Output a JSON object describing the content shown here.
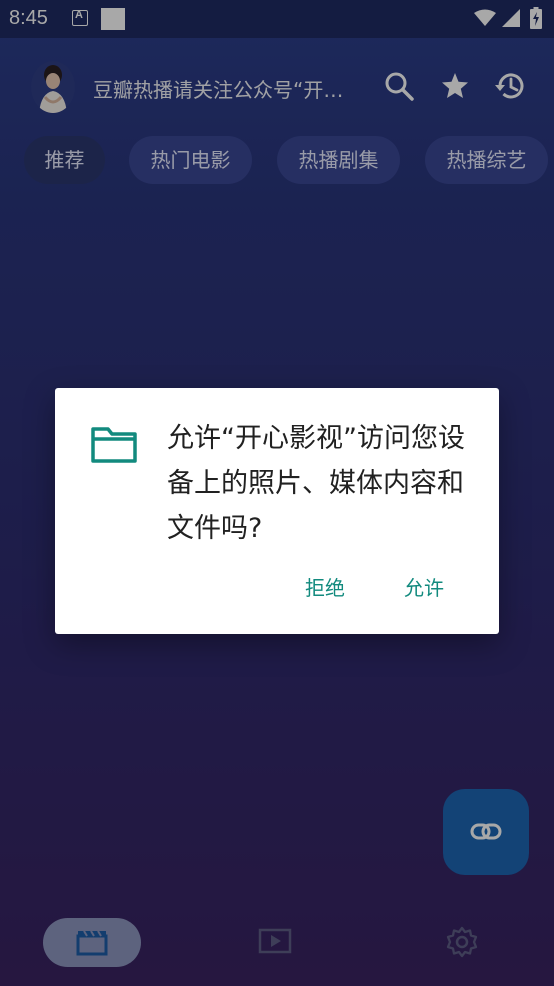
{
  "status_bar": {
    "time": "8:45",
    "notification_icon_letter": "A",
    "icons": [
      "a-app-icon",
      "white-square-icon",
      "wifi-icon",
      "signal-icon",
      "battery-charging-icon"
    ]
  },
  "app_bar": {
    "title": "豆瓣热播请关注公众号“开心影视”",
    "icons": [
      "search-icon",
      "star-icon",
      "history-icon"
    ]
  },
  "tabs": [
    {
      "label": "推荐",
      "active": true
    },
    {
      "label": "热门电影",
      "active": false
    },
    {
      "label": "热播剧集",
      "active": false
    },
    {
      "label": "热播综艺",
      "active": false
    }
  ],
  "dialog": {
    "icon": "folder-icon",
    "message": "允许“开心影视”访问您设备上的照片、媒体内容和文件吗?",
    "deny_label": "拒绝",
    "allow_label": "允许",
    "accent_color": "#128a7e"
  },
  "fab": {
    "icon": "link-icon"
  },
  "bottom_nav": {
    "items": [
      {
        "icon": "clapperboard-icon",
        "active": true
      },
      {
        "icon": "play-box-icon",
        "active": false
      },
      {
        "icon": "settings-gear-icon",
        "active": false
      }
    ]
  },
  "colors": {
    "background_top": "#2c3f8c",
    "background_bottom": "#3a2361",
    "fab": "#1d67b4",
    "nav_pill": "#8e96bf"
  }
}
